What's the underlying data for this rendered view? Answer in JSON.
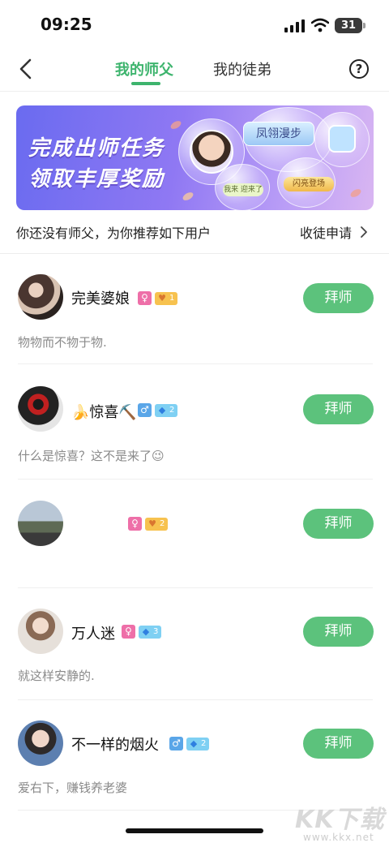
{
  "status_bar": {
    "time": "09:25",
    "battery": "31"
  },
  "nav": {
    "tabs": [
      {
        "label": "我的师父",
        "active": true
      },
      {
        "label": "我的徒弟",
        "active": false
      }
    ],
    "help_label": "?"
  },
  "banner": {
    "line1": "完成出师任务",
    "line2": "领取丰厚奖励",
    "tag_feng": "凤翎漫步",
    "tag_wo": "我来 迎来了",
    "tag_shanliang": "闪亮登场"
  },
  "hint": {
    "text": "你还没有师父，为你推荐如下用户",
    "apply_label": "收徒申请"
  },
  "users": [
    {
      "name": "完美婆娘",
      "gender": "female",
      "level_type": "gold",
      "level": "1",
      "bio": "物物而不物于物.",
      "button": "拜师"
    },
    {
      "name": "🍌惊喜⛏️",
      "gender": "male",
      "level_type": "diamond",
      "level": "2",
      "bio": "什么是惊喜？这不是来了😉",
      "button": "拜师"
    },
    {
      "name": "",
      "gender": "female",
      "level_type": "gold",
      "level": "2",
      "bio": "",
      "button": "拜师"
    },
    {
      "name": "万人迷",
      "gender": "female",
      "level_type": "diamond",
      "level": "3",
      "bio": "就这样安静的.",
      "button": "拜师"
    },
    {
      "name": "不一样的烟火",
      "gender": "male",
      "level_type": "diamond",
      "level": "2",
      "bio": "爱右下，赚钱养老婆",
      "button": "拜师"
    }
  ],
  "icons": {
    "female": "♀",
    "male": "♂",
    "gold_level": "💛",
    "diamond_level": "💎"
  },
  "watermark": {
    "big": "KK下载",
    "small": "www.kkx.net"
  },
  "colors": {
    "accent": "#3db46d",
    "button": "#5cc27c"
  }
}
